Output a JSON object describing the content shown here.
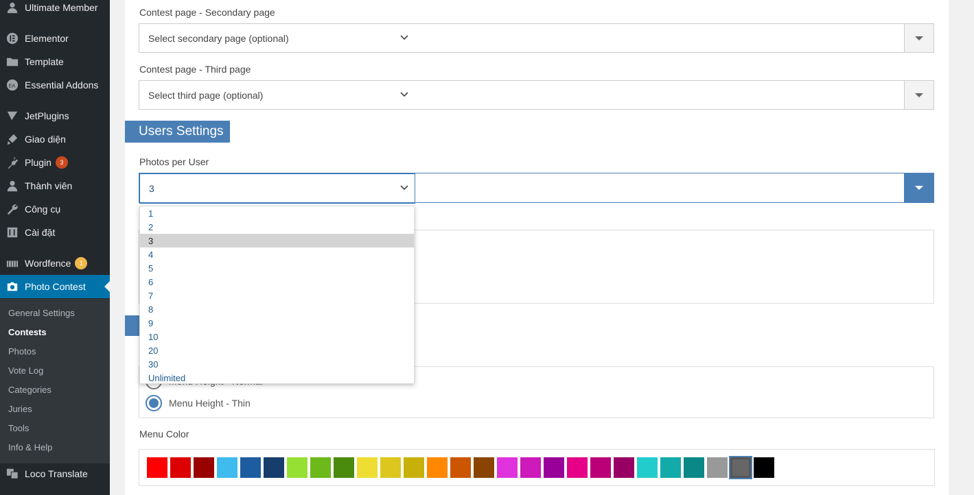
{
  "sidebar": {
    "items": [
      {
        "label": "Ultimate Member",
        "icon": "user-icon"
      },
      {
        "label": "Elementor",
        "icon": "elementor-icon"
      },
      {
        "label": "Template",
        "icon": "folder-icon"
      },
      {
        "label": "Essential Addons",
        "icon": "ea-icon"
      },
      {
        "label": "JetPlugins",
        "icon": "jet-icon"
      },
      {
        "label": "Giao diện",
        "icon": "brush-icon"
      },
      {
        "label": "Plugin",
        "icon": "plug-icon",
        "badge": "3"
      },
      {
        "label": "Thành viên",
        "icon": "user-icon"
      },
      {
        "label": "Công cụ",
        "icon": "wrench-icon"
      },
      {
        "label": "Cài đặt",
        "icon": "settings-icon"
      },
      {
        "label": "Wordfence",
        "icon": "wordfence-icon",
        "badge": "1"
      },
      {
        "label": "Photo Contest",
        "icon": "camera-icon"
      },
      {
        "label": "Loco Translate",
        "icon": "translate-icon"
      }
    ],
    "submenu": [
      "General Settings",
      "Contests",
      "Photos",
      "Vote Log",
      "Categories",
      "Juries",
      "Tools",
      "Info & Help"
    ],
    "current_submenu": "Contests"
  },
  "form": {
    "secondary_label": "Contest page - Secondary page",
    "secondary_placeholder": "Select secondary page (optional)",
    "third_label": "Contest page - Third page",
    "third_placeholder": "Select third page (optional)",
    "users_settings_title": "Users Settings",
    "photos_per_user_label": "Photos per User",
    "photos_per_user_value": "3",
    "photos_options": [
      "1",
      "2",
      "3",
      "4",
      "5",
      "6",
      "7",
      "8",
      "9",
      "10",
      "20",
      "30",
      "Unlimited"
    ],
    "radio_normal": "Menu Height - Normal",
    "radio_thin": "Menu Height - Thin",
    "menu_color_label": "Menu Color",
    "colors": [
      "#ff0000",
      "#dd0000",
      "#990000",
      "#3fbbee",
      "#1e5ca0",
      "#163d6b",
      "#96e033",
      "#6db81a",
      "#4a8a0c",
      "#eedd33",
      "#ddc61d",
      "#c8b00a",
      "#ff8800",
      "#cc5500",
      "#884400",
      "#e033dd",
      "#cc1abb",
      "#990099",
      "#e60088",
      "#bb0077",
      "#990066",
      "#22cccc",
      "#13aaaa",
      "#0a8888",
      "#999999",
      "#666666",
      "#000000"
    ],
    "selected_color": "#666666"
  }
}
